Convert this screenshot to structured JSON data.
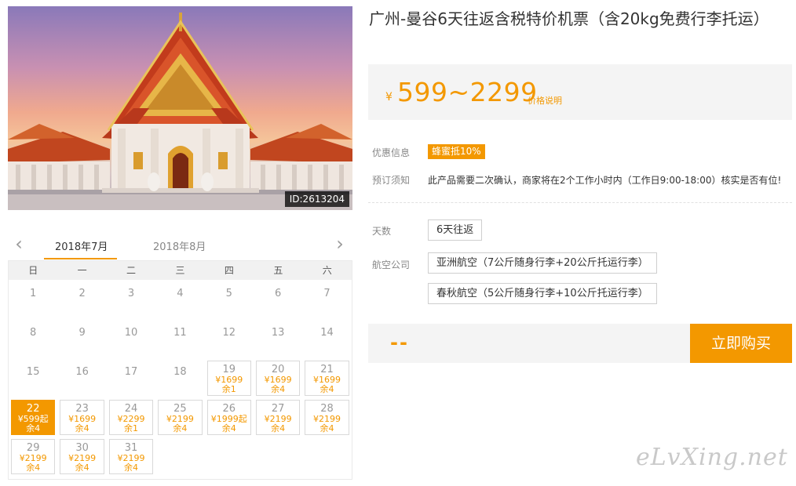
{
  "image": {
    "id_label": "ID:2613204"
  },
  "product": {
    "title": "广州-曼谷6天往返含税特价机票（含20kg免费行李托运）"
  },
  "price": {
    "currency": "¥",
    "range": "599~2299",
    "note": "价格说明"
  },
  "info": {
    "promo_label": "优惠信息",
    "promo_badge": "蜂蜜抵10%",
    "booking_label": "预订须知",
    "booking_text": "此产品需要二次确认，商家将在2个工作小时内（工作日9:00-18:00）核实是否有位!"
  },
  "options": {
    "days_label": "天数",
    "days": [
      "6天往返"
    ],
    "airline_label": "航空公司",
    "airlines": [
      "亚洲航空（7公斤随身行李+20公斤托运行李）",
      "春秋航空（5公斤随身行李+10公斤托运行李）"
    ]
  },
  "buy": {
    "total": "--",
    "button_label": "立即购买"
  },
  "calendar": {
    "prev_arrow": "‹",
    "next_arrow": "›",
    "months": [
      "2018年7月",
      "2018年8月"
    ],
    "active_month": 0,
    "weekdays": [
      "日",
      "一",
      "二",
      "三",
      "四",
      "五",
      "六"
    ],
    "weeks": [
      [
        {
          "day": "1"
        },
        {
          "day": "2"
        },
        {
          "day": "3"
        },
        {
          "day": "4"
        },
        {
          "day": "5"
        },
        {
          "day": "6"
        },
        {
          "day": "7"
        }
      ],
      [
        {
          "day": "8"
        },
        {
          "day": "9"
        },
        {
          "day": "10"
        },
        {
          "day": "11"
        },
        {
          "day": "12"
        },
        {
          "day": "13"
        },
        {
          "day": "14"
        }
      ],
      [
        {
          "day": "15"
        },
        {
          "day": "16"
        },
        {
          "day": "17"
        },
        {
          "day": "18"
        },
        {
          "day": "19",
          "price": "¥1699",
          "remain": "余1"
        },
        {
          "day": "20",
          "price": "¥1699",
          "remain": "余4"
        },
        {
          "day": "21",
          "price": "¥1699",
          "remain": "余4"
        }
      ],
      [
        {
          "day": "22",
          "price": "¥599起",
          "remain": "余4",
          "selected": true
        },
        {
          "day": "23",
          "price": "¥1699",
          "remain": "余4"
        },
        {
          "day": "24",
          "price": "¥2299",
          "remain": "余1"
        },
        {
          "day": "25",
          "price": "¥2199",
          "remain": "余4"
        },
        {
          "day": "26",
          "price": "¥1999起",
          "remain": "余4"
        },
        {
          "day": "27",
          "price": "¥2199",
          "remain": "余4"
        },
        {
          "day": "28",
          "price": "¥2199",
          "remain": "余4"
        }
      ],
      [
        {
          "day": "29",
          "price": "¥2199",
          "remain": "余4"
        },
        {
          "day": "30",
          "price": "¥2199",
          "remain": "余4"
        },
        {
          "day": "31",
          "price": "¥2199",
          "remain": "余4"
        }
      ]
    ]
  },
  "watermark": "eLvXing.net",
  "colors": {
    "accent": "#f39800",
    "panel_bg": "#f4f4f4"
  }
}
